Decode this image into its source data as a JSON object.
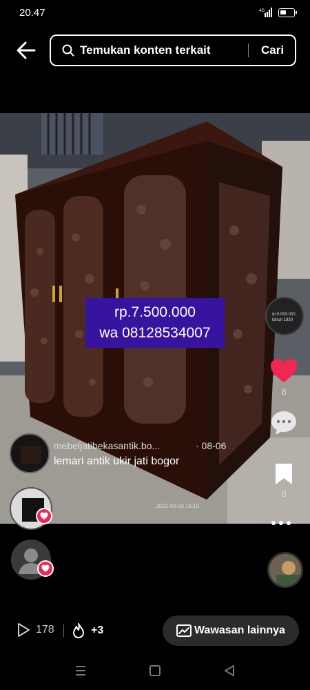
{
  "status_bar": {
    "time": "20.47"
  },
  "search": {
    "placeholder": "Temukan konten terkait",
    "button_label": "Cari"
  },
  "overlay": {
    "price": "rp.7.500.000",
    "contact": "wa 08128534007"
  },
  "side_rail": {
    "thumb_text_1": "rp.5.000.000",
    "thumb_text_2": "tahun 1930",
    "like_count": "8",
    "save_count": "0"
  },
  "post": {
    "author": "mebeljatibekasantik.bo...",
    "date": "· 08-06",
    "caption": "lemari antik ukir jati bogor",
    "watermark": "2021-03-03 16:15"
  },
  "stats": {
    "views": "178",
    "boost": "+3",
    "insights_label": "Wawasan lainnya"
  },
  "colors": {
    "price_bg": "#37149f",
    "like": "#ee2753"
  },
  "icons": [
    "back-arrow-icon",
    "search-icon",
    "heart-icon",
    "comment-icon",
    "bookmark-icon",
    "more-icon",
    "play-icon",
    "flame-icon",
    "chart-icon"
  ]
}
